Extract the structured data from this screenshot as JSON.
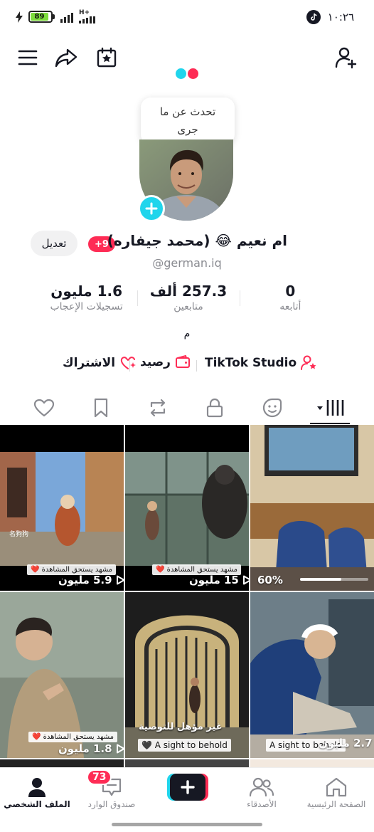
{
  "status_bar": {
    "battery": "89",
    "network": "H+",
    "time": "١٠:٢٦",
    "colors": {
      "battery_fill": "#7ddc3c"
    }
  },
  "top_bar": {
    "menu_icon": "hamburger-menu-icon",
    "share_icon": "share-arrow-icon",
    "calendar_icon": "calendar-star-icon",
    "add_friend_icon": "add-person-icon"
  },
  "bubble": {
    "text_line1": "تحدث عن ما",
    "text_line2": "جرى"
  },
  "profile": {
    "display_name": "ام نعيم 😂 (محمد جيفاره)",
    "badge": "+9",
    "edit_label": "تعديل",
    "username": "@german.iq",
    "bio": "م"
  },
  "stats": [
    {
      "number": "0",
      "label": "أتابعه"
    },
    {
      "number": "257.3 ألف",
      "label": "متابعين"
    },
    {
      "number": "1.6 مليون",
      "label": "تسجيلات الإعجاب"
    }
  ],
  "links": {
    "studio": "TikTok Studio",
    "balance": "رصيد",
    "subscription": "الاشتراك"
  },
  "tabs": [
    "grid",
    "stickers",
    "private",
    "reposts",
    "saved",
    "liked"
  ],
  "videos": [
    {
      "views": "5.9 مليون",
      "tag": "مشهد يستحق المشاهدة ❤️",
      "overlay": "名狗狗"
    },
    {
      "views": "15 مليون",
      "tag": "مشهد يستحق المشاهدة ❤️"
    },
    {
      "views": "60%",
      "progress": 0.6
    },
    {
      "views": "1.8 مليون",
      "tag": "مشهد يستحق المشاهدة ❤️"
    },
    {
      "views": "",
      "tag": "غير مؤهل للتوصية",
      "caption": "A sight to behold 🖤"
    },
    {
      "views": "2.7 مليون",
      "caption": "A sight to behold"
    }
  ],
  "bottom_nav": {
    "home": "الصفحة الرئيسية",
    "friends": "الأصدقاء",
    "inbox": "صندوق الوارد",
    "inbox_count": "73",
    "profile": "الملف الشخصي"
  },
  "colors": {
    "accent_red": "#fe2c55",
    "accent_cyan": "#20d5ec",
    "text_muted": "#8a8b91"
  }
}
